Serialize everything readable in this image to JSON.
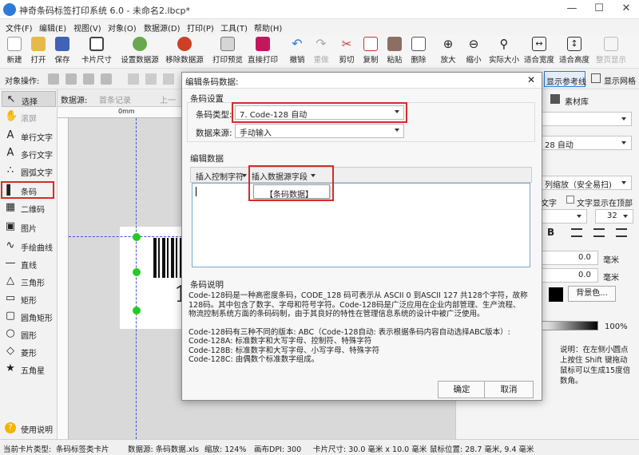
{
  "window": {
    "title": "神奇条码标签打印系统 6.0 - 未命名2.lbcp*",
    "minimize": "—",
    "maximize": "☐",
    "close": "✕"
  },
  "menu": [
    "文件(F)",
    "编辑(E)",
    "视图(V)",
    "对象(O)",
    "数据源(D)",
    "打印(P)",
    "工具(T)",
    "帮助(H)"
  ],
  "toolbar": [
    "新建",
    "打开",
    "保存",
    "卡片尺寸",
    "设置数据源",
    "移除数据源",
    "打印预览",
    "直接打印",
    "撤销",
    "重做",
    "剪切",
    "复制",
    "粘贴",
    "删除",
    "放大",
    "缩小",
    "实际大小",
    "适合宽度",
    "适合高度",
    "整页显示"
  ],
  "objbar": {
    "label": "对象操作:",
    "ref_label": "显示参考线",
    "grid_label": "显示网格"
  },
  "left_tools": [
    {
      "label": "选择",
      "glyph": "↖"
    },
    {
      "label": "滚屏",
      "glyph": "✋"
    },
    {
      "label": "单行文字",
      "glyph": "A"
    },
    {
      "label": "多行文字",
      "glyph": "A"
    },
    {
      "label": "圆弧文字",
      "glyph": "∴"
    },
    {
      "label": "条码",
      "glyph": "▌"
    },
    {
      "label": "二维码",
      "glyph": "▦"
    },
    {
      "label": "图片",
      "glyph": "▣"
    },
    {
      "label": "手绘曲线",
      "glyph": "∿"
    },
    {
      "label": "直线",
      "glyph": "—"
    },
    {
      "label": "三角形",
      "glyph": "△"
    },
    {
      "label": "矩形",
      "glyph": "▭"
    },
    {
      "label": "圆角矩形",
      "glyph": "▢"
    },
    {
      "label": "圆形",
      "glyph": "○"
    },
    {
      "label": "菱形",
      "glyph": "◇"
    },
    {
      "label": "五角星",
      "glyph": "★"
    }
  ],
  "help": "使用说明",
  "canvas": {
    "datasource_label": "数据源:",
    "first_record": "首条记录",
    "prev": "上一",
    "ruler_zero": "0mm",
    "barcode_digit": "1"
  },
  "rightpanel": {
    "tab_material": "素材库",
    "barcode_type": "28 自动",
    "scale_mode": "列缩放（安全易扫)",
    "text_label": "文字",
    "text_top_label": "文字显示在顶部",
    "font_size": "32",
    "bold": "B",
    "left_val": "0.0",
    "left_unit": "毫米",
    "top_val": "0.0",
    "top_unit": "毫米",
    "bg_btn": "背景色...",
    "opacity": "100%",
    "hint": "说明：在左侧小圆点上按住 Shift 键拖动鼠标可以生成15度倍数角。"
  },
  "status": {
    "card_type_label": "当前卡片类型:",
    "card_type_value": "条码标签类卡片",
    "datasource": "数据源: 条码数据.xls",
    "zoom": "缩放: 124%",
    "dpi": "画布DPI: 300",
    "card_size": "卡片尺寸: 30.0 毫米 x 10.0 毫米",
    "mouse_pos": "鼠标位置: 28.7 毫米, 9.4 毫米"
  },
  "dialog": {
    "title": "编辑条码数据:",
    "close": "✕",
    "section_settings": "条码设置",
    "type_label": "条码类型:",
    "type_value": "7. Code-128 自动",
    "source_label": "数据来源:",
    "source_value": "手动输入",
    "section_edit": "编辑数据",
    "btn_insert_control": "插入控制字符",
    "btn_insert_field": "插入数据源字段",
    "field_item": "【条码数据】",
    "section_desc": "条码说明",
    "desc_lines": [
      "Code-128码是一种高密度条码，CODE_128 码可表示从 ASCII 0 到ASCII 127 共128个字符，故称",
      "128码。其中包含了数字、字母和符号字符。Code-128码是广泛应用在企业内部管理、生产流程、",
      "物流控制系统方面的条码码制，由于其良好的特性在管理信息系统的设计中被广泛使用。",
      "",
      "Code-128码有三种不同的版本: ABC（Code-128自动: 表示根据条码内容自动选择ABC版本）:",
      "Code-128A: 标准数字和大写字母、控制符、特殊字符",
      "Code-128B: 标准数字和大写字母、小写字母、特殊字符",
      "Code-128C: 由偶数个标准数字组成。"
    ],
    "ok": "确定",
    "cancel": "取消"
  },
  "colors": {
    "highlight": "#d62b2b",
    "accent": "#2e7bd6",
    "handle": "#22cc22"
  }
}
